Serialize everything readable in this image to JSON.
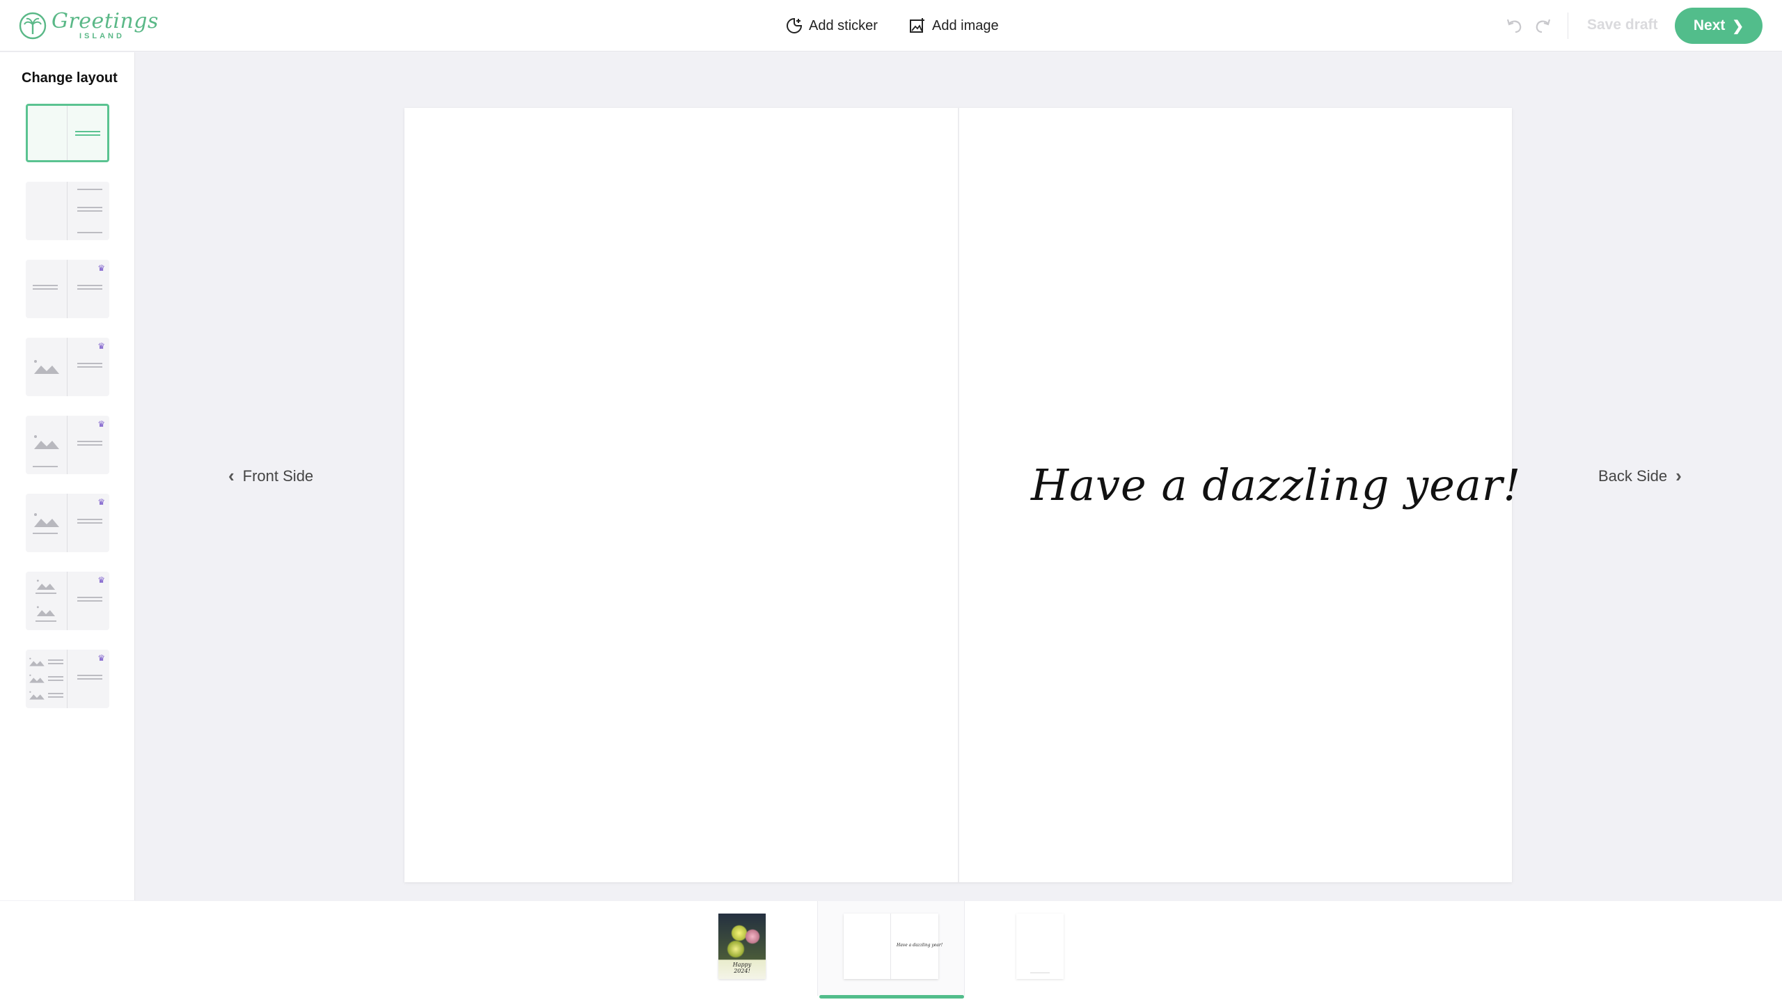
{
  "app": {
    "logo_main": "Greetings",
    "logo_sub": "ISLAND"
  },
  "toolbar": {
    "add_sticker_label": "Add sticker",
    "add_image_label": "Add image",
    "save_draft_label": "Save draft",
    "next_label": "Next",
    "accent_color": "#52bd8b"
  },
  "sidebar": {
    "title": "Change layout",
    "layouts": [
      {
        "id": "text-right",
        "premium": false,
        "selected": true
      },
      {
        "id": "text-right-spaced",
        "premium": false,
        "selected": false
      },
      {
        "id": "text-both",
        "premium": true,
        "selected": false
      },
      {
        "id": "image-text",
        "premium": true,
        "selected": false
      },
      {
        "id": "image-caption-text",
        "premium": true,
        "selected": false
      },
      {
        "id": "image-caption-text-2",
        "premium": true,
        "selected": false
      },
      {
        "id": "two-images-text",
        "premium": true,
        "selected": false
      },
      {
        "id": "three-images-text",
        "premium": true,
        "selected": false
      }
    ],
    "premium_icon": "crown-icon",
    "premium_color": "#7a5acb"
  },
  "canvas": {
    "greeting": "Have a dazzling year!"
  },
  "nav": {
    "front_side": "Front Side",
    "back_side": "Back Side"
  },
  "pages": {
    "front_text_line1": "Happy",
    "front_text_line2": "2024!",
    "inside_text": "Have a dazzling year!",
    "active": "inside"
  }
}
